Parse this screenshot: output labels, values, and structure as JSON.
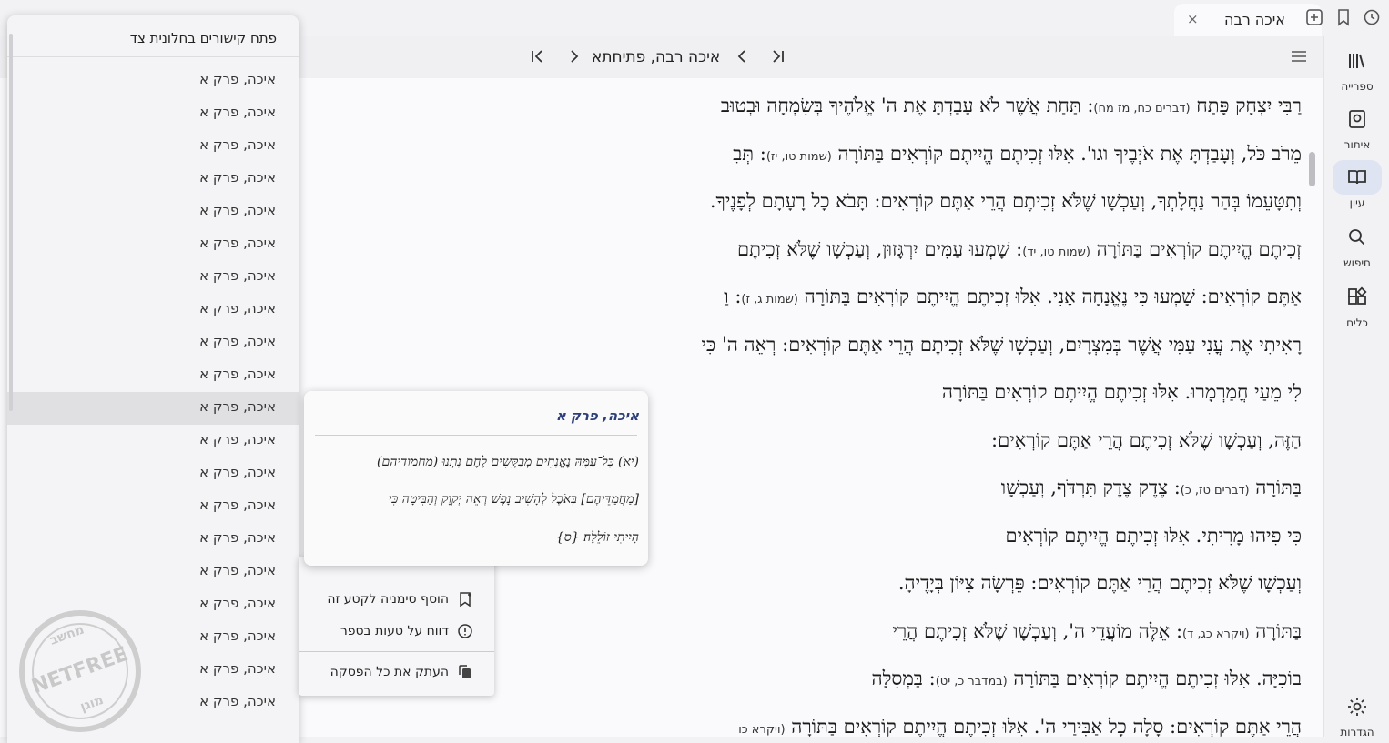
{
  "tab": {
    "title": "איכה רבה",
    "close": "×"
  },
  "nav": {
    "title": "איכה רבה, פתיחתא"
  },
  "rail": [
    {
      "label": "ספרייה",
      "icon": "library-icon",
      "active": false
    },
    {
      "label": "איתור",
      "icon": "locate-icon",
      "active": false
    },
    {
      "label": "עיון",
      "icon": "book-open-icon",
      "active": true
    },
    {
      "label": "חיפוש",
      "icon": "search-icon",
      "active": false
    },
    {
      "label": "כלים",
      "icon": "tools-icon",
      "active": false
    },
    {
      "label": "הגדרות",
      "icon": "gear-icon",
      "active": false
    }
  ],
  "text_lines": [
    {
      "a": "רַבִּי יִצְחָק פָּתַח ",
      "ref": "(דברים כח, מז מח)",
      "b": ": תַּחַת אֲשֶׁר לֹא עָבַדְתָּ אֶת ה' אֱלֹהֶיךָ בְּשִׂמְחָה וּבְטוּב"
    },
    {
      "a": "מֵרֹב כֹּל, וְעָבַדְתָּ אֶת אֹיְבֶיךָ וגו'. אִלּוּ זְכִיתֶם הֱיִיתֶם קוֹרְאִים בַּתּוֹרָה ",
      "ref": "(שמות טו, יז)",
      "b": ": תְּבִ"
    },
    {
      "a": "וְתִטָּעֵמוֹ בְּהַר נַחֲלָתְךָ, וְעַכְשָׁו שֶׁלֹּא זְכִיתֶם הֲרֵי אַתֶּם קוֹרְאִים: תָּבֹא כָל רָעָתָם לְפָנֶיךָ.",
      "ref": "",
      "b": ""
    },
    {
      "a": "זְכִיתֶם הֱיִיתֶם קוֹרְאִים בַּתּוֹרָה ",
      "ref": "(שמות טו, יד)",
      "b": ": שָׁמְעוּ עַמִּים יִרְגָּזוּן, וְעַכְשָׁו שֶׁלֹּא זְכִיתֶם"
    },
    {
      "a": "אַתֶּם קוֹרְאִים: שָׁמְעוּ כִּי נֶאֱנָחָה אָנִי. אִלּוּ זְכִיתֶם הֱיִיתֶם קוֹרְאִים בַּתּוֹרָה ",
      "ref": "(שמות ג, ז)",
      "b": ": וַ"
    },
    {
      "a": "רָאִיתִי אֶת עֳנִי עַמִּי אֲשֶׁר בְּמִצְרָיִם, וְעַכְשָׁו שֶׁלֹּא זְכִיתֶם הֲרֵי אַתֶּם קוֹרְאִים: רְאֵה ה' כִּי",
      "ref": "",
      "b": ""
    },
    {
      "a": "לִי מֵעַי חֳמַרְמָרוּ. אִלּוּ זְכִיתֶם הֱיִיתֶם קוֹרְאִים בַּתּוֹרָה",
      "ref": "",
      "b": ""
    },
    {
      "a": "הַזֶּה, וְעַכְשָׁו שֶׁלֹּא זְכִיתֶם הֲרֵי אַתֶּם קוֹרְאִים:",
      "ref": "",
      "b": ""
    },
    {
      "a": "בַּתּוֹרָה ",
      "ref": "(דברים טז, כ)",
      "b": ": צֶדֶק צֶדֶק תִּרְדֹּף, וְעַכְשָׁו"
    },
    {
      "a": "כִּי פִיהוּ מָרִיתִי. אִלּוּ זְכִיתֶם הֱיִיתֶם קוֹרְאִים",
      "ref": "",
      "b": ""
    },
    {
      "a": "וְעַכְשָׁו שֶׁלֹּא זְכִיתֶם הֲרֵי אַתֶּם קוֹרְאִים: פֵּרְשָׂה צִיּוֹן בְּיָדֶיהָ.",
      "ref": "",
      "b": ""
    },
    {
      "a": "בַּתּוֹרָה ",
      "ref": "(ויקרא כג, ד)",
      "b": ": אֵלֶּה מוֹעֲדֵי ה', וְעַכְשָׁו שֶׁלֹּא זְכִיתֶם הֲרֵי"
    },
    {
      "a": "בוֹכִיָּה. אִלּוּ זְכִיתֶם הֱיִיתֶם קוֹרְאִים בַּתּוֹרָה ",
      "ref": "(במדבר כ, יט)",
      "b": ": בַּמְסִלָּה"
    },
    {
      "a": "הֲרֵי אַתֶּם קוֹרְאִים: סָלָה כָל אַבִּירַי ה'. אִלּוּ זְכִיתֶם הֱיִיתֶם קוֹרְאִים בַּתּוֹרָה ",
      "ref": "(ויקרא כו",
      "b": ""
    }
  ],
  "links_panel": {
    "header": "פתח קישורים בחלונית צד",
    "items": [
      "איכה, פרק א",
      "איכה, פרק א",
      "איכה, פרק א",
      "איכה, פרק א",
      "איכה, פרק א",
      "איכה, פרק א",
      "איכה, פרק א",
      "איכה, פרק א",
      "איכה, פרק א",
      "איכה, פרק א",
      "איכה, פרק א",
      "איכה, פרק א",
      "איכה, פרק א",
      "איכה, פרק א",
      "איכה, פרק א",
      "איכה, פרק א",
      "איכה, פרק א",
      "איכה, פרק א",
      "איכה, פרק א",
      "איכה, פרק א"
    ],
    "selected_index": 10
  },
  "preview": {
    "title": "איכה, פרק א",
    "lines": [
      "(יא) כָּל־עַמָּהּ נֶאֱנָחִים מְבַקְּשִׁים לֶחֶם נָתְנוּ (מחמודיהם)",
      "[מַחֲמַדֵּיהֶם] בְּאֹכֶל לְהָשִׁיב נָפֶשׁ רְאֵה יְקוָק וְהַבִּיטָה כִּי",
      "הָיִיתִי זוֹלֵלָה׃ {ס}"
    ]
  },
  "context_menu": {
    "items": [
      {
        "label": "הוסף סימניה לקטע זה",
        "icon": "bookmark-add-icon"
      },
      {
        "label": "דווח על טעות בספר",
        "icon": "info-icon"
      },
      {
        "label": "העתק את כל הפסקה",
        "icon": "copy-icon"
      }
    ]
  },
  "watermark": {
    "top": "מחשב",
    "middle": "NETFREE",
    "bottom": "מוגן"
  }
}
